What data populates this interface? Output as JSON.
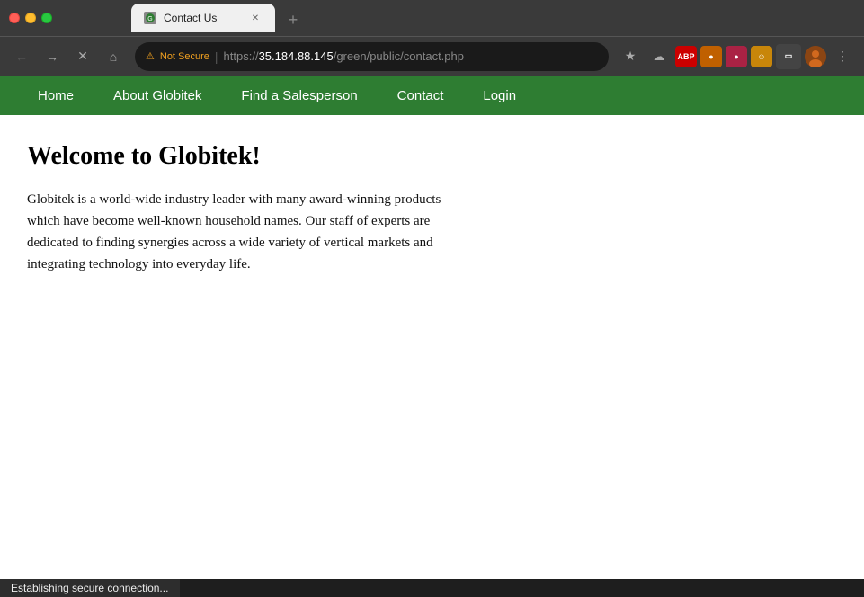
{
  "browser": {
    "title_bar": {
      "tab_title": "Contact Us",
      "new_tab_label": "+"
    },
    "address_bar": {
      "not_secure_label": "Not Secure",
      "url_protocol": "https://",
      "url_host": "35.184.88.145",
      "url_path": "/green/public/contact.php",
      "back_icon": "←",
      "forward_icon": "→",
      "reload_icon": "✕",
      "home_icon": "⌂",
      "bookmark_icon": "☆",
      "more_icon": "⋮"
    }
  },
  "site": {
    "nav": {
      "items": [
        {
          "label": "Home",
          "href": "#"
        },
        {
          "label": "About Globitek",
          "href": "#"
        },
        {
          "label": "Find a Salesperson",
          "href": "#"
        },
        {
          "label": "Contact",
          "href": "#"
        },
        {
          "label": "Login",
          "href": "#"
        }
      ]
    },
    "content": {
      "title": "Welcome to Globitek!",
      "body": "Globitek is a world-wide industry leader with many award-winning products which have become well-known household names. Our staff of experts are dedicated to finding synergies across a wide variety of vertical markets and integrating technology into everyday life."
    }
  },
  "status_bar": {
    "text": "Establishing secure connection..."
  }
}
